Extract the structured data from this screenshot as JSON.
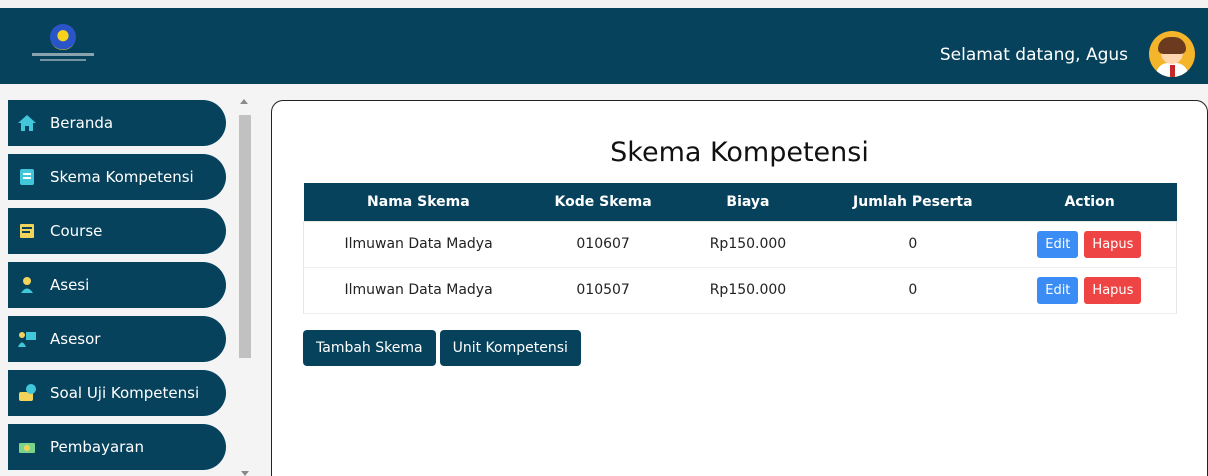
{
  "header": {
    "welcome": "Selamat datang, Agus",
    "logo_icon": "lsp-logo-icon",
    "avatar_icon": "user-avatar-icon",
    "bg_color": "#07425d"
  },
  "sidebar": {
    "items": [
      {
        "label": "Beranda",
        "icon": "home-icon"
      },
      {
        "label": "Skema Kompetensi",
        "icon": "document-icon"
      },
      {
        "label": "Course",
        "icon": "book-icon"
      },
      {
        "label": "Asesi",
        "icon": "person-icon"
      },
      {
        "label": "Asesor",
        "icon": "teacher-icon"
      },
      {
        "label": "Soal Uji Kompetensi",
        "icon": "quiz-icon"
      },
      {
        "label": "Pembayaran",
        "icon": "money-icon"
      }
    ]
  },
  "main": {
    "title": "Skema Kompetensi",
    "table": {
      "headers": [
        "Nama Skema",
        "Kode Skema",
        "Biaya",
        "Jumlah Peserta",
        "Action"
      ],
      "rows": [
        {
          "nama": "Ilmuwan Data Madya",
          "kode": "010607",
          "biaya": "Rp150.000",
          "peserta": "0",
          "edit": "Edit",
          "hapus": "Hapus"
        },
        {
          "nama": "Ilmuwan Data Madya",
          "kode": "010507",
          "biaya": "Rp150.000",
          "peserta": "0",
          "edit": "Edit",
          "hapus": "Hapus"
        }
      ]
    },
    "buttons": {
      "tambah": "Tambah Skema",
      "unit": "Unit Kompetensi"
    }
  },
  "colors": {
    "primary": "#07425d",
    "edit": "#3b8cf4",
    "hapus": "#ef4444"
  }
}
